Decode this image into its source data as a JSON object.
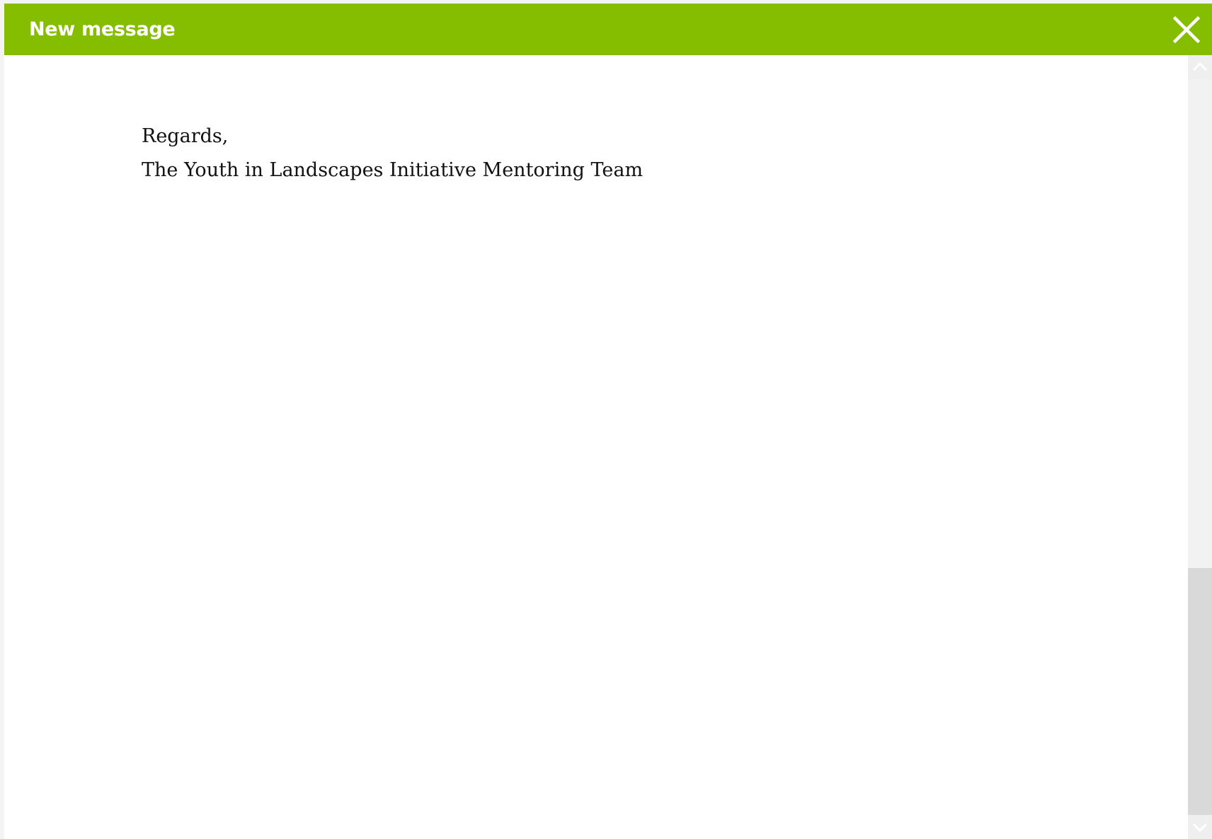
{
  "dialog": {
    "title": "New message",
    "close_icon": "close-icon"
  },
  "message": {
    "lines": [
      "Regards,",
      "The Youth in Landscapes Initiative Mentoring Team"
    ]
  },
  "colors": {
    "header_background": "#85bd00",
    "header_text": "#ffffff",
    "body_text": "#111111",
    "scroll_track": "#f2f2f2",
    "scroll_thumb": "#d9d9d9"
  },
  "icons": {
    "scroll_up": "chevron-up-icon",
    "scroll_down": "chevron-down-icon"
  }
}
